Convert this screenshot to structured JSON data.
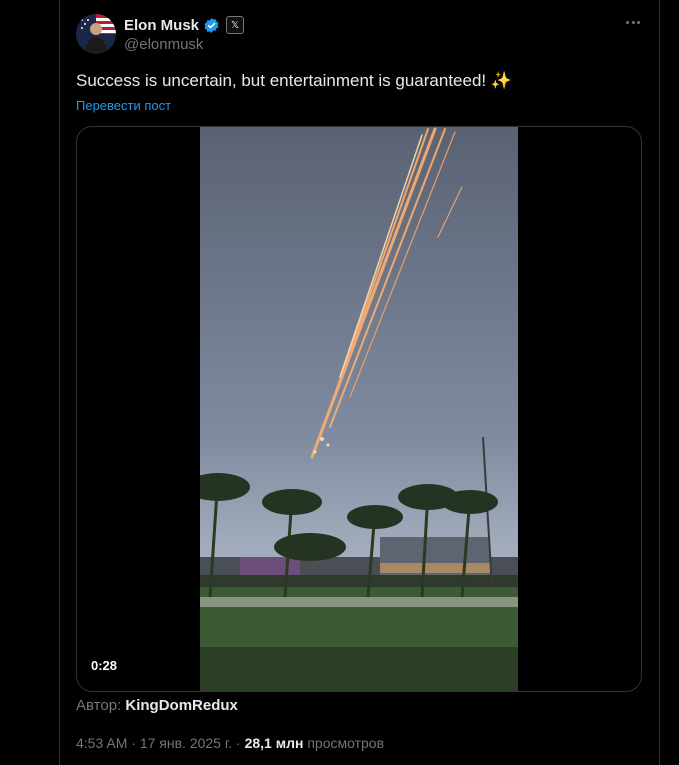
{
  "author": {
    "name": "Elon Musk",
    "handle": "@elonmusk",
    "affiliate_badge": "𝕏"
  },
  "tweet": {
    "text": "Success is uncertain, but entertainment is guaranteed!",
    "emoji": "✨",
    "translate_label": "Перевести пост"
  },
  "media": {
    "duration": "0:28",
    "credit_prefix": "Автор:",
    "credit_name": "KingDomRedux"
  },
  "meta": {
    "time": "4:53 AM",
    "separator": "·",
    "date": "17 янв. 2025 г.",
    "views_count": "28,1 млн",
    "views_label": "просмотров"
  },
  "icons": {
    "verified": "verified-badge-icon",
    "more": "more-options-icon"
  },
  "colors": {
    "accent": "#1d9bf0",
    "background": "#000000",
    "muted": "#71767b",
    "text": "#e7e9ea"
  }
}
